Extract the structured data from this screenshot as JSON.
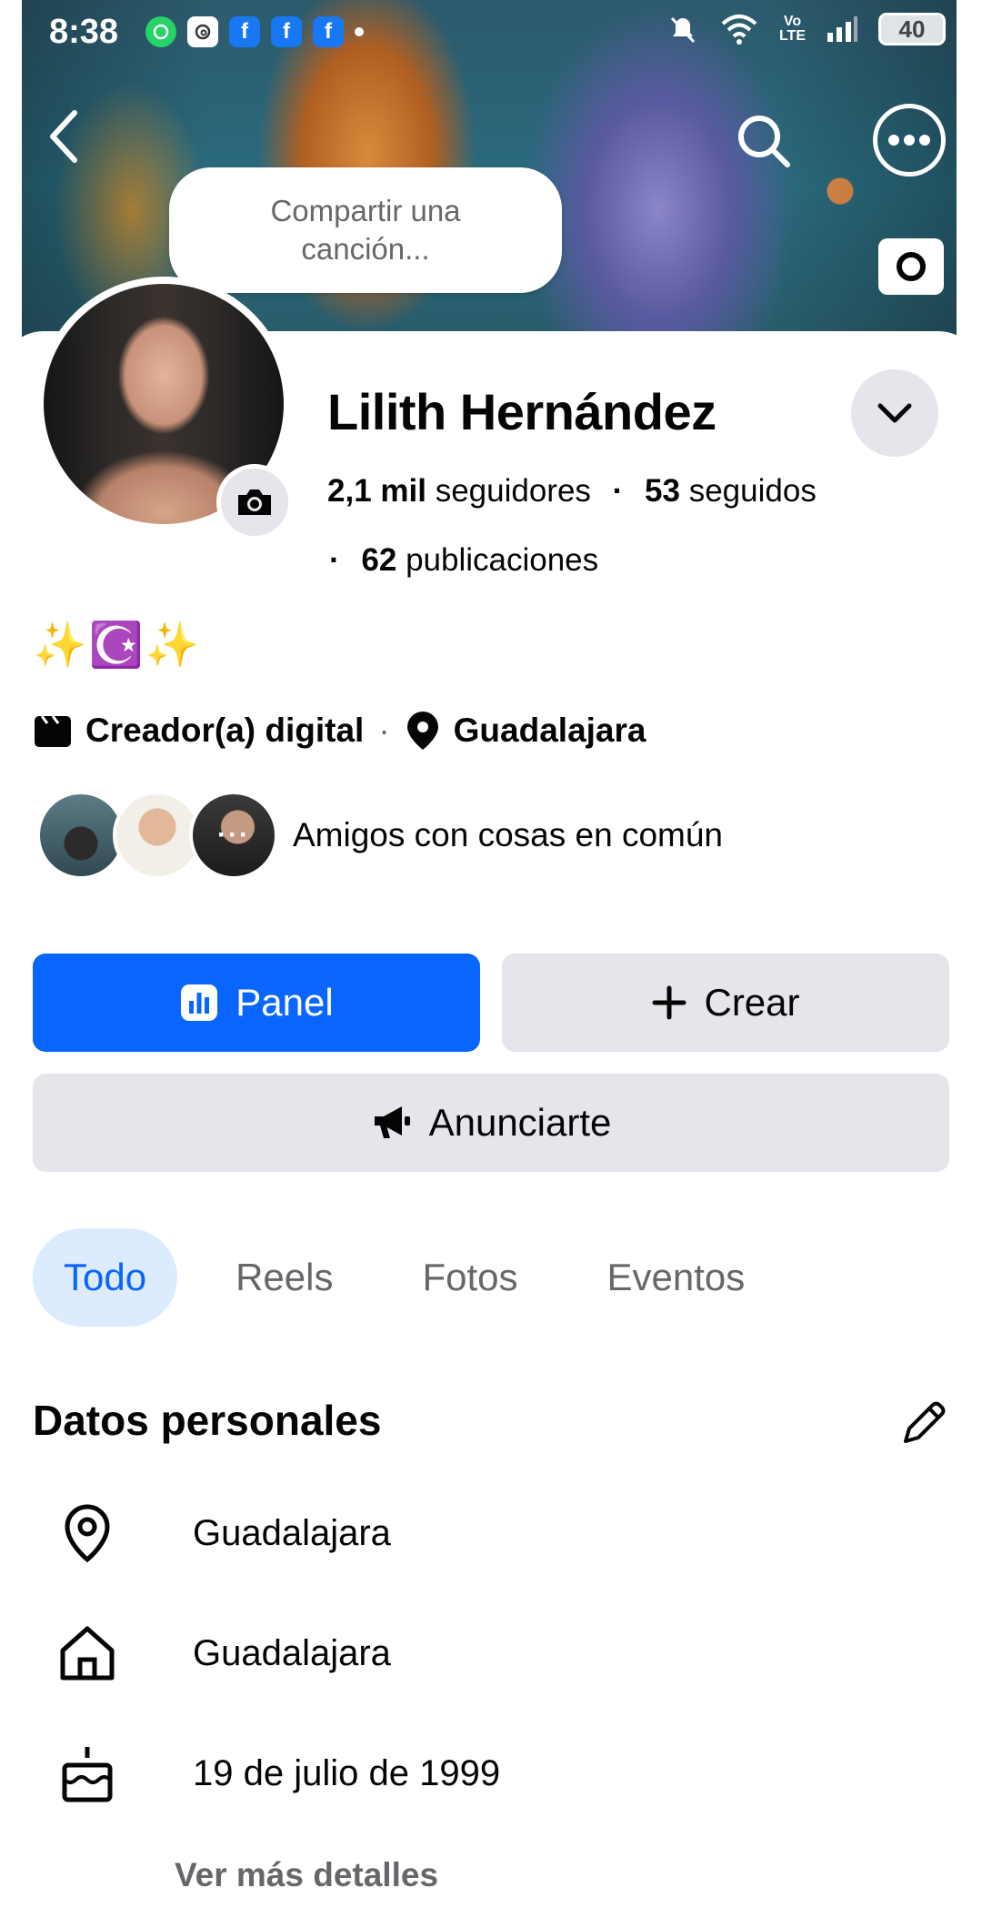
{
  "status_bar": {
    "time": "8:38",
    "volte_top": "Vo",
    "volte_bottom": "LTE",
    "battery": "40",
    "app_icons": [
      "whatsapp-icon",
      "threads-icon",
      "facebook-icon",
      "facebook-icon",
      "facebook-icon"
    ]
  },
  "cover": {
    "song_prompt": "Compartir una canción..."
  },
  "profile": {
    "name": "Lilith Hernández",
    "followers_count": "2,1 mil",
    "followers_label": "seguidores",
    "following_count": "53",
    "following_label": "seguidos",
    "posts_count": "62",
    "posts_label": "publicaciones",
    "bio": "✨☪️✨",
    "category": "Creador(a) digital",
    "location": "Guadalajara",
    "friends_label": "Amigos con cosas en común",
    "friends_more": "···"
  },
  "actions": {
    "panel": "Panel",
    "create": "Crear",
    "advertise": "Anunciarte"
  },
  "tabs": [
    "Todo",
    "Reels",
    "Fotos",
    "Eventos"
  ],
  "active_tab": "Todo",
  "personal": {
    "title": "Datos personales",
    "current_city": "Guadalajara",
    "hometown": "Guadalajara",
    "birthday": "19 de julio de 1999",
    "see_more": "Ver más detalles"
  },
  "colors": {
    "primary": "#0866ff",
    "button_grey": "#e4e6eb",
    "active_tab_bg": "#dcebfd",
    "muted_text": "#65676b"
  }
}
